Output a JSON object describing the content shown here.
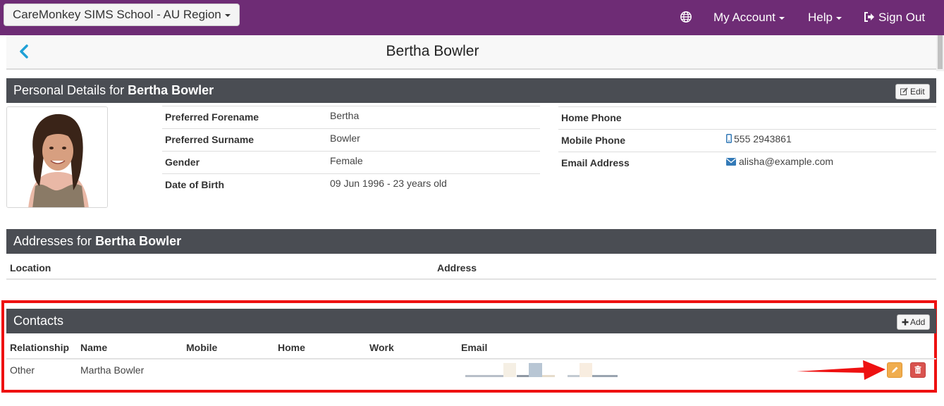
{
  "topbar": {
    "school": "CareMonkey SIMS School - AU Region",
    "my_account": "My Account",
    "help": "Help",
    "sign_out": "Sign Out",
    "bg_color": "#6e2c75"
  },
  "page": {
    "title": "Bertha Bowler"
  },
  "personal": {
    "heading_prefix": "Personal Details for ",
    "heading_name": "Bertha Bowler",
    "edit_label": "Edit",
    "fields": [
      {
        "label": "Preferred Forename",
        "value": "Bertha"
      },
      {
        "label": "Preferred Surname",
        "value": "Bowler"
      },
      {
        "label": "Gender",
        "value": "Female"
      },
      {
        "label": "Date of Birth",
        "value": "09 Jun 1996 - 23 years old"
      }
    ],
    "contact_fields": [
      {
        "label": "Home Phone",
        "value": ""
      },
      {
        "label": "Mobile Phone",
        "value": "555 2943861"
      },
      {
        "label": "Email Address",
        "value": "alisha@example.com"
      }
    ]
  },
  "addresses": {
    "heading_prefix": "Addresses for ",
    "heading_name": "Bertha Bowler",
    "columns": [
      "Location",
      "Address"
    ]
  },
  "contacts": {
    "heading": "Contacts",
    "add_label": "Add",
    "columns": [
      "Relationship",
      "Name",
      "Mobile",
      "Home",
      "Work",
      "Email"
    ],
    "rows": [
      {
        "relationship": "Other",
        "name": "Martha Bowler"
      }
    ]
  },
  "colors": {
    "section_head": "#4a4d53",
    "link": "#337ab7",
    "edit_button": "#f0ad4e",
    "delete_button": "#d9534f",
    "highlight": "#ee1111"
  }
}
